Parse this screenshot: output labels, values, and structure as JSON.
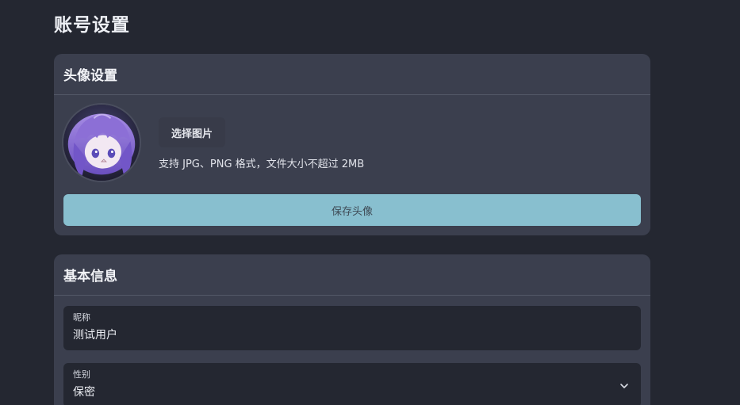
{
  "page": {
    "title": "账号设置"
  },
  "avatar_card": {
    "title": "头像设置",
    "choose_label": "选择图片",
    "hint": "支持 JPG、PNG 格式，文件大小不超过 2MB",
    "save_label": "保存头像",
    "avatar_alt": "用户头像"
  },
  "basic_card": {
    "title": "基本信息",
    "nickname": {
      "label": "昵称",
      "value": "测试用户"
    },
    "gender": {
      "label": "性别",
      "value": "保密"
    }
  },
  "colors": {
    "background": "#242731",
    "card": "#3b3f4e",
    "accent_button": "#88bfcf"
  }
}
